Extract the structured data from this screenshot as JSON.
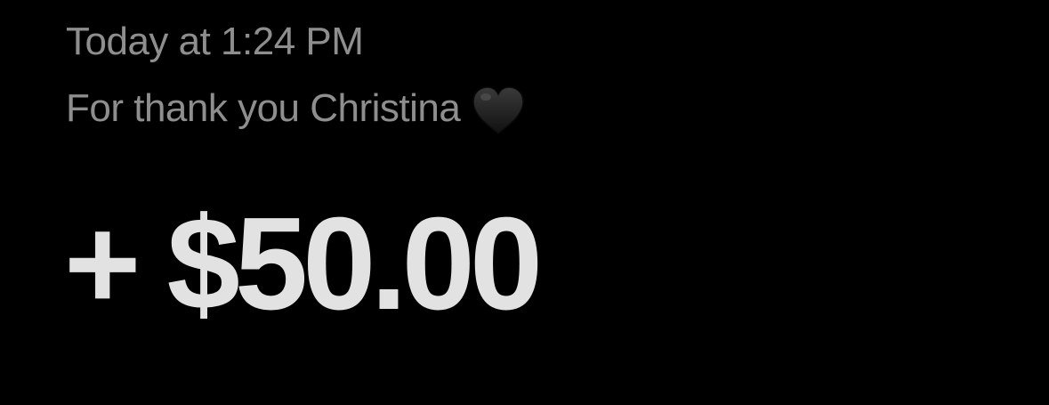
{
  "transaction": {
    "timestamp": "Today at 1:24 PM",
    "memo": "For thank you Christina",
    "memo_emoji_icon": "black-heart-icon",
    "amount": "+ $50.00"
  },
  "colors": {
    "background": "#000000",
    "secondary_text": "#8e8e8e",
    "amount_text": "#e2e2e2",
    "heart": "#1a1a1a"
  }
}
